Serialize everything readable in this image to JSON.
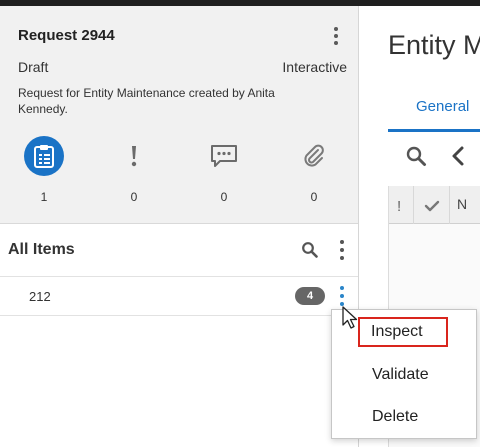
{
  "request": {
    "title": "Request 2944",
    "status": "Draft",
    "mode": "Interactive",
    "description": "Request for Entity Maintenance created by Anita Kennedy.",
    "stats": [
      {
        "icon": "clipboard-list-icon",
        "count": "1",
        "active": true
      },
      {
        "icon": "exclamation-icon",
        "count": "0",
        "active": false
      },
      {
        "icon": "comment-icon",
        "count": "0",
        "active": false
      },
      {
        "icon": "paperclip-icon",
        "count": "0",
        "active": false
      }
    ]
  },
  "items": {
    "title": "All Items",
    "rows": [
      {
        "label": "212",
        "badge": "4"
      }
    ]
  },
  "entity": {
    "title": "Entity M",
    "tab": "General",
    "grid_header_excl": "!",
    "grid_header_n": "N"
  },
  "context_menu": {
    "items": [
      "Inspect",
      "Validate",
      "Delete"
    ]
  },
  "colors": {
    "accent": "#1a73c6",
    "focus_border": "#d9251d",
    "badge_bg": "#666666",
    "card_bg": "#f1f1f1"
  }
}
